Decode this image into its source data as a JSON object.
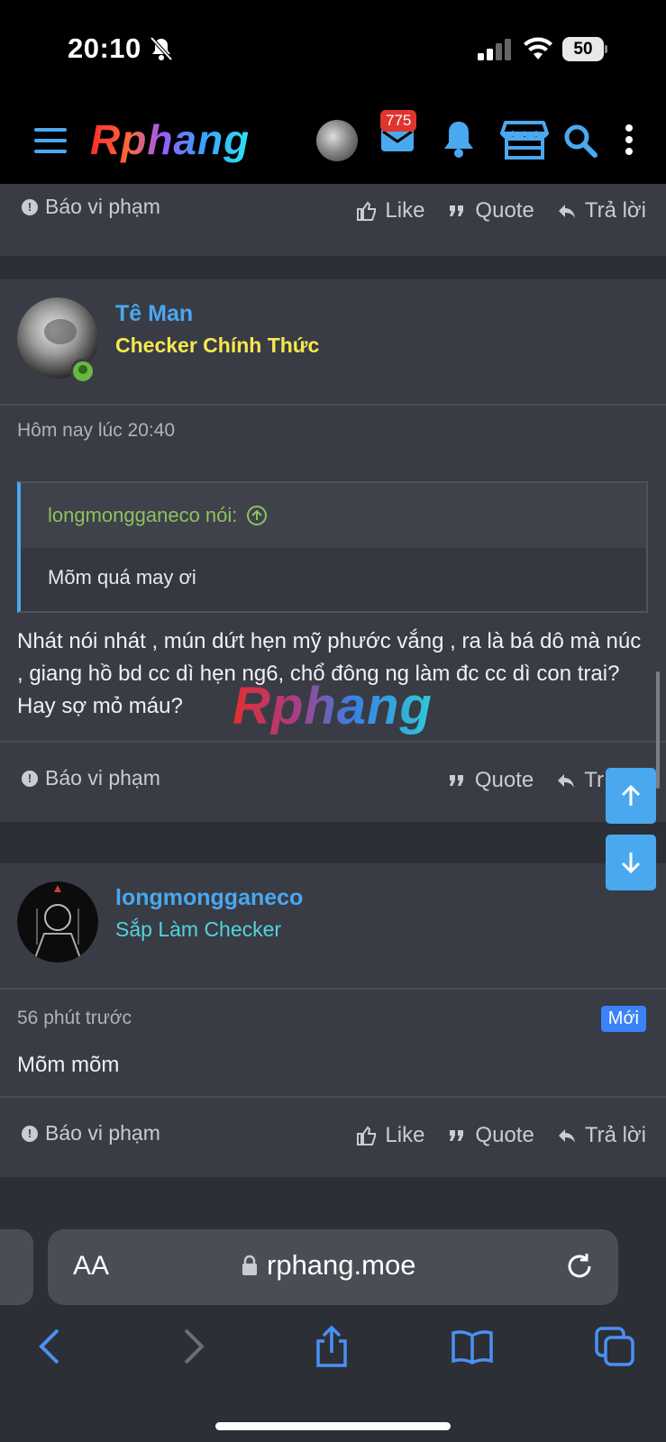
{
  "status_bar": {
    "time": "20:10",
    "battery": "50"
  },
  "header": {
    "logo": "Rphang",
    "mail_count": "775"
  },
  "top_footer": {
    "report": "Báo vi phạm",
    "like": "Like",
    "quote": "Quote",
    "reply": "Trả lời"
  },
  "post1": {
    "username": "Tê Man",
    "user_title": "Checker Chính Thức",
    "user_title_color": "#f5e94c",
    "date": "Hôm nay lúc 20:40",
    "quote_author": "longmongganeco nói:",
    "quote_text": "Mõm quá may ơi",
    "message": "Nhát nói nhát , mún dứt hẹn mỹ phước vắng , ra là bá dô mà núc , giang hồ bd cc dì hẹn ng6, chổ đông ng làm đc cc dì con trai? Hay sợ mỏ máu?",
    "watermark": "Rphang",
    "footer": {
      "report": "Báo vi phạm",
      "quote": "Quote",
      "reply": "Tr"
    }
  },
  "post2": {
    "username": "longmongganeco",
    "user_title": "Sắp Làm Checker",
    "user_title_color": "#52d3dc",
    "date": "56 phút trước",
    "new_badge": "Mới",
    "message": "Mõm mõm",
    "footer": {
      "report": "Báo vi phạm",
      "like": "Like",
      "quote": "Quote",
      "reply": "Trả lời"
    }
  },
  "browser": {
    "text_size": "AA",
    "url": "rphang.moe"
  },
  "colors": {
    "accent": "#4aa8ef",
    "background": "#2c2f36",
    "panel": "#393c45"
  }
}
